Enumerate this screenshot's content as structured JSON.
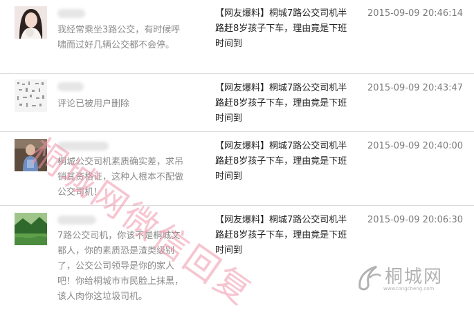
{
  "comments": [
    {
      "comment": "我经常乘坐3路公交，有时候呼啸而过好几辆公交都不会停。",
      "article": "【网友爆料】桐城7路公交司机半路赶8岁孩子下车，理由竟是下班时间到",
      "time": "2015-09-09 20:46:14"
    },
    {
      "comment": "评论已被用户删除",
      "article": "【网友爆料】桐城7路公交司机半路赶8岁孩子下车，理由竟是下班时间到",
      "time": "2015-09-09 20:43:47"
    },
    {
      "comment": "桐城公交司机素质确实差，求吊销其资格证，这种人根本不配做公交司机！",
      "article": "【网友爆料】桐城7路公交司机半路赶8岁孩子下车，理由竟是下班时间到",
      "time": "2015-09-09 20:40:00"
    },
    {
      "comment": "7路公交司机，你该不是桐城文都人，你的素质恐是渣类级别了，公交公司领导是你的家人吧！你给桐城市市民脸上抹黑，该人肉你这垃圾司机。",
      "article": "【网友爆料】桐城7路公交司机半路赶8岁孩子下车，理由竟是下班时间到",
      "time": "2015-09-09 20:06:30"
    }
  ],
  "watermark": "桐城网微信回复",
  "logo": {
    "text": "桐城网",
    "sub": "www.tongcheng.com"
  }
}
